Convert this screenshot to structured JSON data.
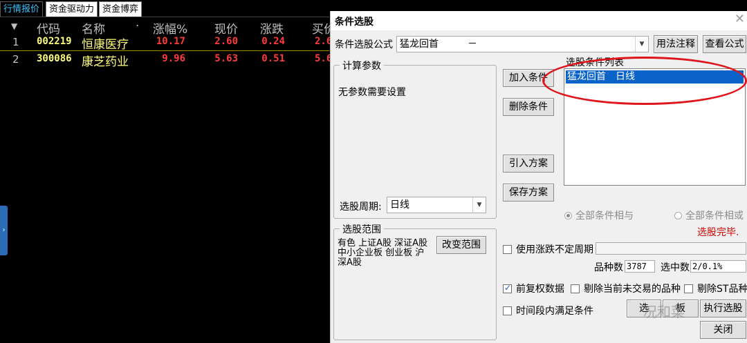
{
  "tabs": [
    "行情报价",
    "资金驱动力",
    "资金博弈"
  ],
  "table": {
    "headers": {
      "sort": "▼",
      "code": "代码",
      "name": "名称",
      "dot": "·",
      "change_pct": "涨幅%",
      "price": "现价",
      "change": "涨跌",
      "bid": "买价"
    },
    "rows": [
      {
        "idx": "1",
        "code": "002219",
        "name": "恒康医疗",
        "change_pct": "10.17",
        "price": "2.60",
        "change": "0.24",
        "bid": "2.6"
      },
      {
        "idx": "2",
        "code": "300086",
        "name": "康芝药业",
        "change_pct": "9.96",
        "price": "5.63",
        "change": "0.51",
        "bid": "5.6"
      }
    ]
  },
  "side_handle": "›",
  "dialog": {
    "title": "条件选股",
    "close": "✕",
    "formula_label": "条件选股公式",
    "formula_value": "猛龙回首　　　－",
    "usage_button": "用法注释",
    "view_formula_button": "查看公式",
    "calc_params_title": "计算参数",
    "no_params": "无参数需要设置",
    "period_label": "选股周期:",
    "period_value": "日线",
    "add_condition": "加入条件",
    "delete_condition": "删除条件",
    "import_plan": "引入方案",
    "save_plan": "保存方案",
    "condition_list_label": "选股条件列表",
    "condition_item": "猛龙回首　日线",
    "radio_and": "全部条件相与",
    "radio_or": "全部条件相或",
    "status": "选股完毕.",
    "range_title": "选股范围",
    "range_text": "有色 上证A股 深证A股 中小企业板 创业板 沪深A股",
    "change_range": "改变范围",
    "use_uncertain": "使用涨跌不定周期",
    "count_label": "品种数",
    "count_value": "3787",
    "selected_label": "选中数",
    "selected_value": "2/0.1%",
    "prefix_adj": "前复权数据",
    "exclude_untraded": "剔除当前未交易的品种",
    "exclude_st": "剔除ST品种",
    "time_period": "时间段内满足条件",
    "btn_a": "选",
    "btn_b": "板",
    "btn_c": "执行选股",
    "close_button": "关闭",
    "watermark": "况和菜"
  }
}
